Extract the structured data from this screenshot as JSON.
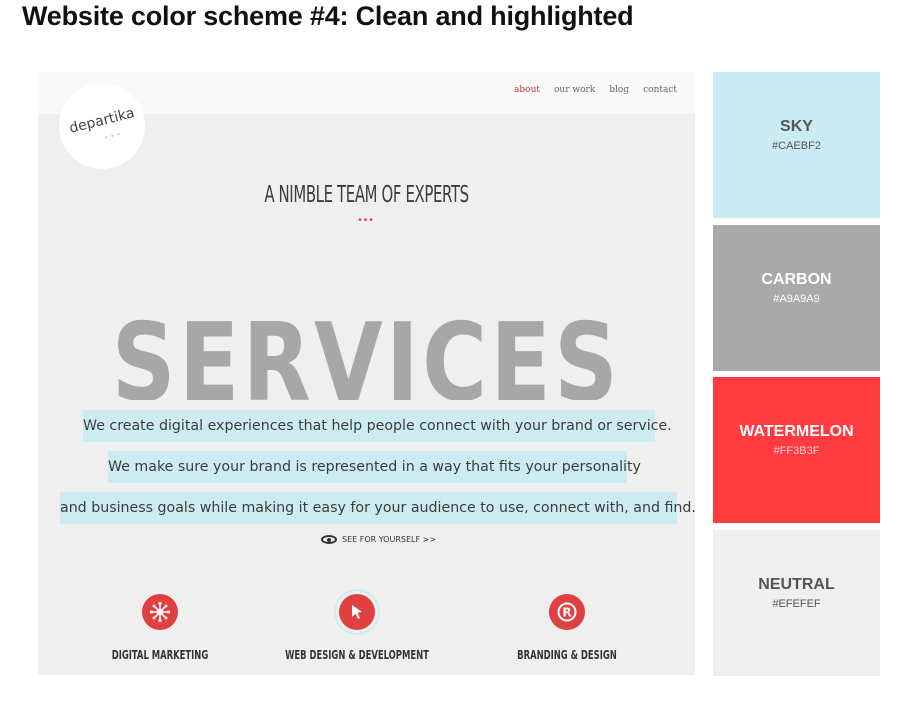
{
  "heading": "Website color scheme #4: Clean and highlighted",
  "site": {
    "logo_text": "departika",
    "logo_dots": "• • •",
    "nav": [
      "about",
      "our work",
      "blog",
      "contact"
    ],
    "headline": "A NIMBLE TEAM OF EXPERTS",
    "divider": "•••",
    "big_word": "SERVICES",
    "lines": [
      "We create digital experiences that help people connect with your brand or service.",
      "We make sure your brand is represented in a way that fits your personality",
      "and business goals while making it easy for your audience to use, connect with, and find."
    ],
    "see_yourself": "SEE FOR YOURSELF >>",
    "services": [
      {
        "label": "DIGITAL MARKETING",
        "icon": "network-icon"
      },
      {
        "label": "WEB DESIGN & DEVELOPMENT",
        "icon": "cursor-icon"
      },
      {
        "label": "BRANDING & DESIGN",
        "icon": "registered-icon"
      }
    ]
  },
  "swatches": [
    {
      "name": "SKY",
      "hex": "#CAEBF2"
    },
    {
      "name": "CARBON",
      "hex": "#A9A9A9"
    },
    {
      "name": "WATERMELON",
      "hex": "#FF3B3F"
    },
    {
      "name": "NEUTRAL",
      "hex": "#EFEFEF"
    }
  ]
}
